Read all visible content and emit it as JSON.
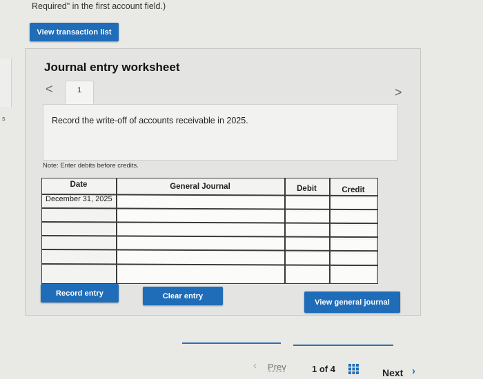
{
  "header": {
    "top_note": "Required\" in the first account field.)",
    "view_transaction_list": "View transaction list"
  },
  "worksheet": {
    "title": "Journal entry worksheet",
    "nav_prev": "<",
    "nav_next": ">",
    "current_tab": "1",
    "description": "Record the write-off of accounts receivable in 2025.",
    "note": "Note: Enter debits before credits."
  },
  "table": {
    "headers": [
      "Date",
      "General Journal",
      "Debit",
      "Credit"
    ],
    "rows": [
      {
        "date": "December 31, 2025",
        "account": "",
        "debit": "",
        "credit": ""
      },
      {
        "date": "",
        "account": "",
        "debit": "",
        "credit": ""
      },
      {
        "date": "",
        "account": "",
        "debit": "",
        "credit": ""
      },
      {
        "date": "",
        "account": "",
        "debit": "",
        "credit": ""
      },
      {
        "date": "",
        "account": "",
        "debit": "",
        "credit": ""
      },
      {
        "date": "",
        "account": "",
        "debit": "",
        "credit": ""
      }
    ]
  },
  "buttons": {
    "record_entry": "Record entry",
    "clear_entry": "Clear entry",
    "view_general_journal": "View general journal"
  },
  "pagination": {
    "prev": "Prev",
    "page_indicator": "1 of 4",
    "next": "Next"
  },
  "colors": {
    "accent_blue": "#1f6db8"
  }
}
